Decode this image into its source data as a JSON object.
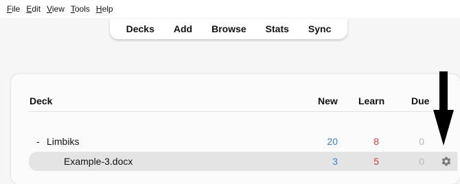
{
  "menubar": {
    "items": [
      {
        "mnemonic": "F",
        "rest": "ile"
      },
      {
        "mnemonic": "E",
        "rest": "dit"
      },
      {
        "mnemonic": "V",
        "rest": "iew"
      },
      {
        "mnemonic": "T",
        "rest": "ools"
      },
      {
        "mnemonic": "H",
        "rest": "elp"
      }
    ]
  },
  "toolbar": {
    "items": [
      "Decks",
      "Add",
      "Browse",
      "Stats",
      "Sync"
    ]
  },
  "table": {
    "headers": {
      "deck": "Deck",
      "new": "New",
      "learn": "Learn",
      "due": "Due"
    },
    "rows": [
      {
        "collapse": "-",
        "name": "Limbiks",
        "new": "20",
        "learn": "8",
        "due": "0"
      },
      {
        "collapse": "",
        "name": "Example-3.docx",
        "new": "3",
        "learn": "5",
        "due": "0"
      }
    ]
  },
  "colors": {
    "new": "#3b82d6",
    "learn": "#d63a3a",
    "due": "#b8b8b8",
    "selected_row": "#e4e4e4"
  },
  "icons": {
    "gear": "gear-icon",
    "arrow": "down-arrow-icon"
  }
}
